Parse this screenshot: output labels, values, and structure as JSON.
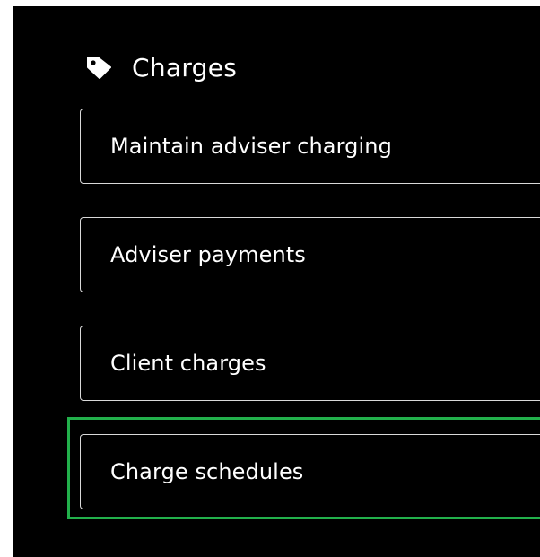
{
  "section": {
    "title": "Charges",
    "icon": "tag-icon"
  },
  "menu": {
    "items": [
      {
        "label": "Maintain adviser charging"
      },
      {
        "label": "Adviser payments"
      },
      {
        "label": "Client charges"
      },
      {
        "label": "Charge schedules",
        "focused": true
      }
    ]
  },
  "colors": {
    "background": "#000000",
    "text": "#ffffff",
    "border": "#d9d9d9",
    "focus": "#22b04b"
  }
}
